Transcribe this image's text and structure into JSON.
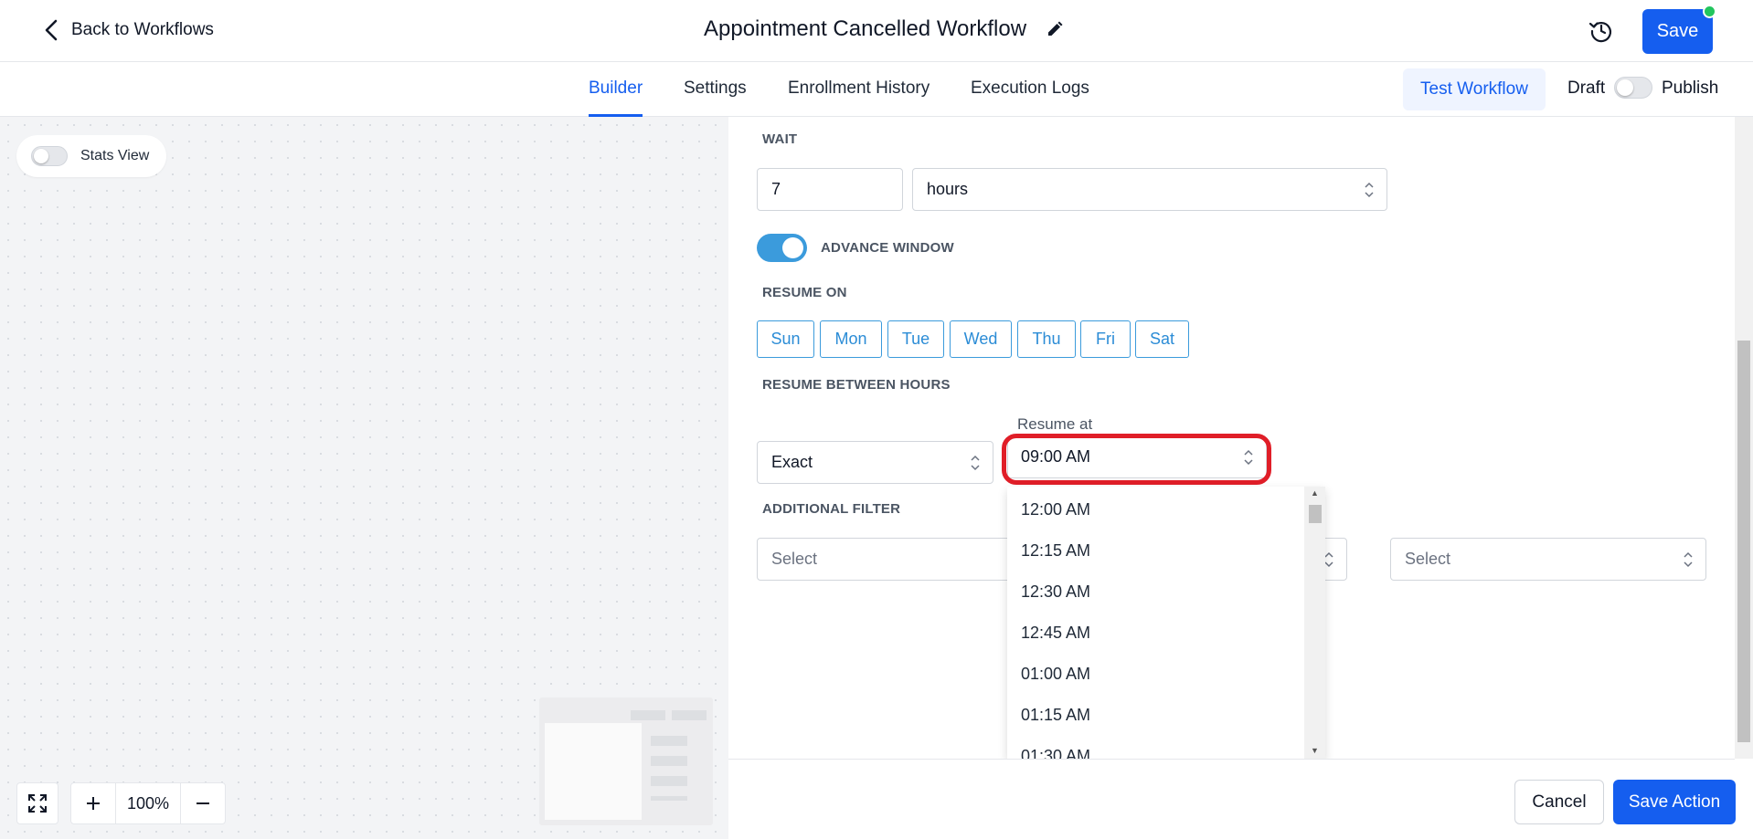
{
  "header": {
    "back_label": "Back to Workflows",
    "title": "Appointment Cancelled Workflow",
    "save_label": "Save"
  },
  "tabs": [
    {
      "label": "Builder",
      "active": true
    },
    {
      "label": "Settings"
    },
    {
      "label": "Enrollment History"
    },
    {
      "label": "Execution Logs"
    }
  ],
  "tabbar": {
    "test_workflow_label": "Test Workflow",
    "draft_label": "Draft",
    "publish_label": "Publish"
  },
  "canvas": {
    "stats_view_label": "Stats View",
    "zoom_level": "100%"
  },
  "panel": {
    "wait_label": "WAIT",
    "wait_value": "7",
    "wait_unit": "hours",
    "advance_window_label": "ADVANCE WINDOW",
    "resume_on_label": "RESUME ON",
    "days": [
      "Sun",
      "Mon",
      "Tue",
      "Wed",
      "Thu",
      "Fri",
      "Sat"
    ],
    "resume_between_label": "RESUME BETWEEN HOURS",
    "mode_value": "Exact",
    "resume_at_label": "Resume at",
    "resume_at_value": "09:00 AM",
    "additional_filter_label": "ADDITIONAL FILTER",
    "filter_placeholder_1": "Select",
    "filter_placeholder_2": "Select"
  },
  "dropdown_options": [
    "12:00 AM",
    "12:15 AM",
    "12:30 AM",
    "12:45 AM",
    "01:00 AM",
    "01:15 AM",
    "01:30 AM"
  ],
  "footer": {
    "cancel_label": "Cancel",
    "save_action_label": "Save Action"
  },
  "colors": {
    "primary": "#155eef",
    "accent_blue": "#3b9bdc",
    "highlight_red": "#e01e28",
    "status_green": "#22c55e"
  }
}
